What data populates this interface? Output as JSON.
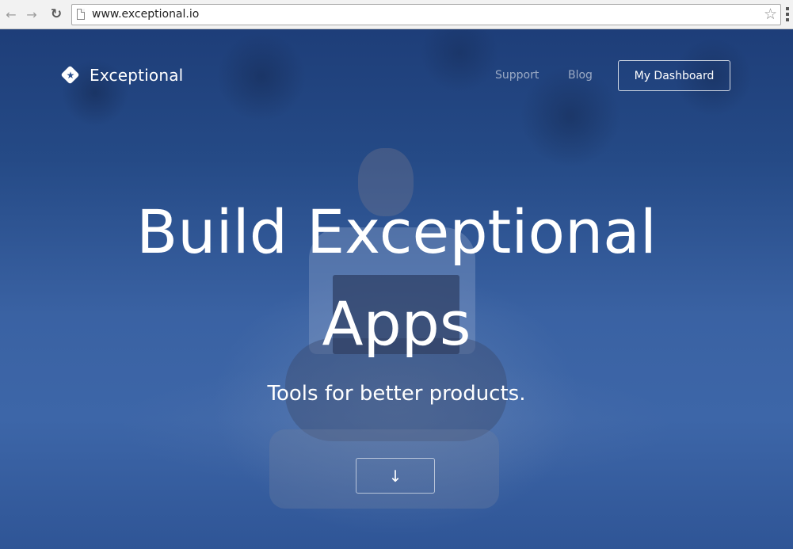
{
  "browser": {
    "url": "www.exceptional.io"
  },
  "site": {
    "logo_text": "Exceptional",
    "nav": {
      "support": "Support",
      "blog": "Blog",
      "dashboard": "My Dashboard"
    },
    "hero": {
      "title_line1": "Build Exceptional",
      "title_line2": "Apps",
      "subtitle": "Tools for better products."
    }
  },
  "icons": {
    "back": "back-arrow-icon",
    "forward": "forward-arrow-icon",
    "reload": "reload-icon",
    "page": "page-icon",
    "bookmark": "star-icon",
    "menu": "menu-icon",
    "logo": "diamond-star-icon",
    "scroll": "arrow-down-icon"
  },
  "colors": {
    "hero_overlay": "#2a4f8e",
    "text": "#ffffff",
    "nav_muted": "#8ea4c8"
  }
}
